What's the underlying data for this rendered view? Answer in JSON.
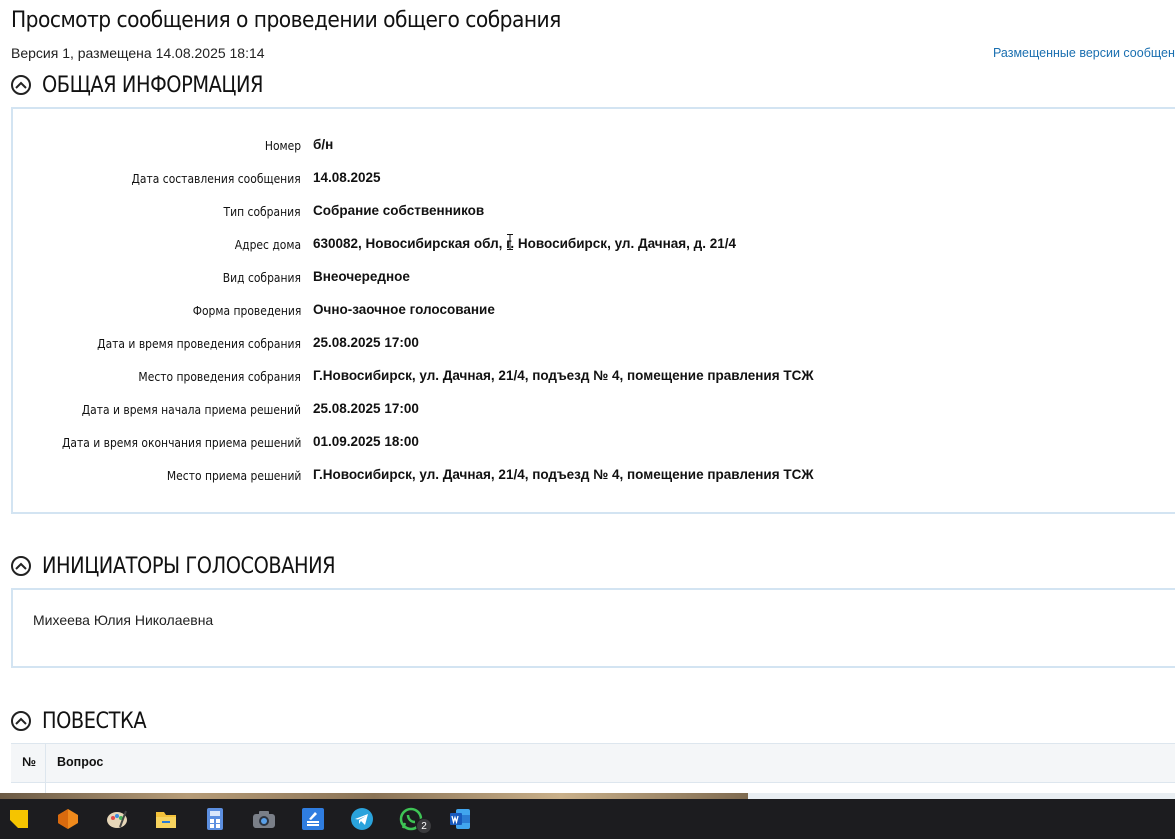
{
  "page": {
    "title": "Просмотр сообщения о проведении общего собрания",
    "version_line": "Версия 1, размещена 14.08.2025 18:14",
    "versions_link": "Размещенные версии сообщения"
  },
  "general": {
    "heading": "ОБЩАЯ ИНФОРМАЦИЯ",
    "rows": [
      {
        "label": "Номер",
        "value": "б/н"
      },
      {
        "label": "Дата составления сообщения",
        "value": "14.08.2025"
      },
      {
        "label": "Тип собрания",
        "value": "Собрание собственников"
      },
      {
        "label": "Адрес дома",
        "value": "630082, Новосибирская обл, г. Новосибирск, ул. Дачная, д. 21/4"
      },
      {
        "label": "Вид собрания",
        "value": "Внеочередное"
      },
      {
        "label": "Форма проведения",
        "value": "Очно-заочное голосование"
      },
      {
        "label": "Дата и время проведения собрания",
        "value": "25.08.2025 17:00"
      },
      {
        "label": "Место проведения собрания",
        "value": "Г.Новосибирск, ул. Дачная, 21/4, подъезд № 4, помещение правления ТСЖ"
      },
      {
        "label": "Дата и время начала приема решений",
        "value": "25.08.2025 17:00"
      },
      {
        "label": "Дата и время окончания приема решений",
        "value": "01.09.2025 18:00"
      },
      {
        "label": "Место приема решений",
        "value": "Г.Новосибирск, ул. Дачная, 21/4, подъезд № 4, помещение правления ТСЖ"
      }
    ]
  },
  "initiators": {
    "heading": "ИНИЦИАТОРЫ ГОЛОСОВАНИЯ",
    "name": "Михеева Юлия Николаевна"
  },
  "agenda": {
    "heading": "ПОВЕСТКА",
    "col_num": "№",
    "col_question": "Вопрос"
  },
  "taskbar": {
    "badge_count": "2",
    "icons": [
      "sticky-notes-icon",
      "app-orange-icon",
      "paint-icon",
      "file-explorer-icon",
      "calculator-icon",
      "camera-icon",
      "scanner-icon",
      "telegram-icon",
      "whatsapp-icon",
      "word-icon"
    ]
  },
  "colors": {
    "accent": "#1a6fb0",
    "panel_border": "#d3e4f2",
    "taskbar": "#1c1c1f"
  }
}
